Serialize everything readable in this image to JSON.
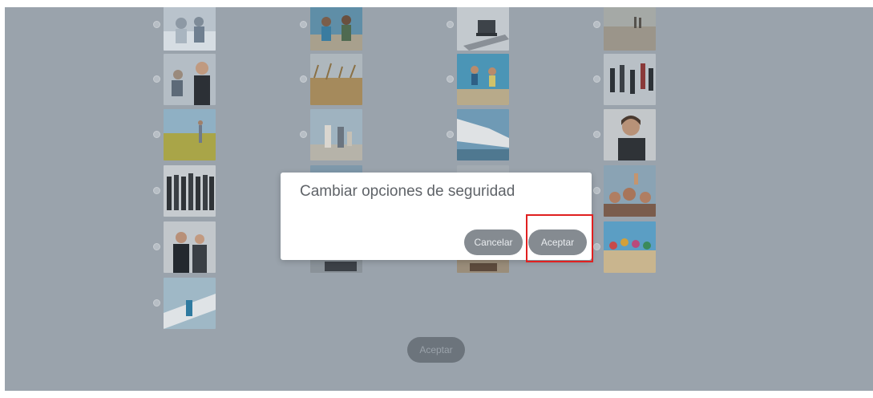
{
  "background_grid": {
    "option_count": 21,
    "options": [
      {
        "icon": "photo-office-meeting"
      },
      {
        "icon": "photo-beach-friends"
      },
      {
        "icon": "photo-laptop-desk"
      },
      {
        "icon": "photo-beach-couple-walking"
      },
      {
        "icon": "photo-business-woman-smiling"
      },
      {
        "icon": "photo-wheat-field"
      },
      {
        "icon": "photo-people-jumping-sky"
      },
      {
        "icon": "photo-business-team-jumping"
      },
      {
        "icon": "photo-woman-in-field"
      },
      {
        "icon": "photo-family-beach-sky"
      },
      {
        "icon": "photo-cruise-ship"
      },
      {
        "icon": "photo-woman-on-phone"
      },
      {
        "icon": "photo-business-group-standing"
      },
      {
        "icon": "photo-hidden-behind-modal"
      },
      {
        "icon": "photo-hidden-behind-modal"
      },
      {
        "icon": "photo-crowd-thumbs-up"
      },
      {
        "icon": "photo-business-handshake"
      },
      {
        "icon": "photo-hidden-behind-modal"
      },
      {
        "icon": "photo-hidden-behind-modal"
      },
      {
        "icon": "photo-colorful-crowd-beach"
      },
      {
        "icon": "photo-woman-on-yacht"
      }
    ],
    "submit_label": "Aceptar"
  },
  "dialog": {
    "title": "Cambiar opciones de seguridad",
    "cancel_label": "Cancelar",
    "accept_label": "Aceptar"
  },
  "colors": {
    "overlay": "#9aa3ac",
    "dialog_bg": "#ffffff",
    "button_bg": "#858b91",
    "highlight": "#e02020"
  }
}
